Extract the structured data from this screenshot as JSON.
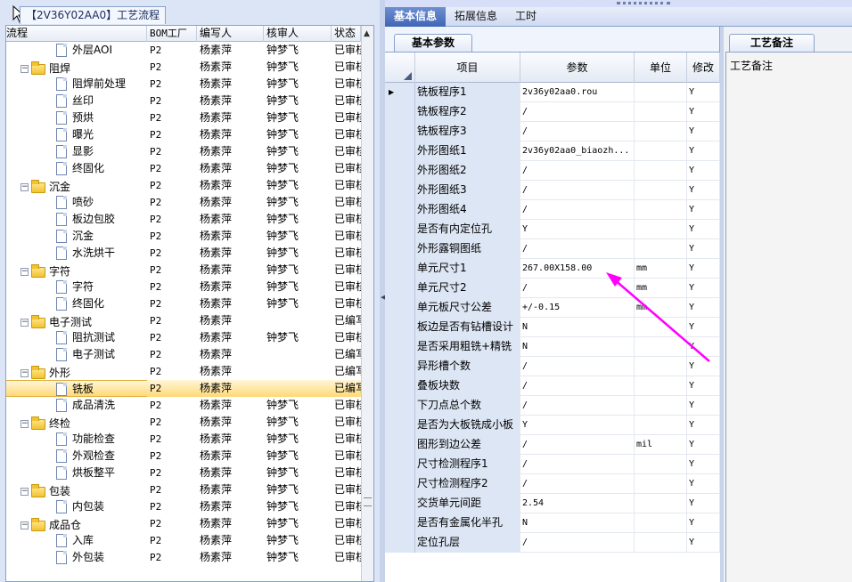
{
  "window": {
    "title": "【2V36Y02AA0】工艺流程"
  },
  "tree": {
    "columns": [
      "流程",
      "BOM工厂",
      "编写人",
      "核审人",
      "状态"
    ],
    "rows": [
      {
        "level": 1,
        "kind": "doc",
        "name": "外层AOI",
        "bom": "P2",
        "writer": "杨素萍",
        "reviewer": "钟梦飞",
        "status": "已审核",
        "selected": false
      },
      {
        "level": 0,
        "kind": "folder",
        "name": "阻焊",
        "bom": "P2",
        "writer": "杨素萍",
        "reviewer": "钟梦飞",
        "status": "已审核",
        "selected": false
      },
      {
        "level": 1,
        "kind": "doc",
        "name": "阻焊前处理",
        "bom": "P2",
        "writer": "杨素萍",
        "reviewer": "钟梦飞",
        "status": "已审核",
        "selected": false
      },
      {
        "level": 1,
        "kind": "doc",
        "name": "丝印",
        "bom": "P2",
        "writer": "杨素萍",
        "reviewer": "钟梦飞",
        "status": "已审核",
        "selected": false
      },
      {
        "level": 1,
        "kind": "doc",
        "name": "预烘",
        "bom": "P2",
        "writer": "杨素萍",
        "reviewer": "钟梦飞",
        "status": "已审核",
        "selected": false
      },
      {
        "level": 1,
        "kind": "doc",
        "name": "曝光",
        "bom": "P2",
        "writer": "杨素萍",
        "reviewer": "钟梦飞",
        "status": "已审核",
        "selected": false
      },
      {
        "level": 1,
        "kind": "doc",
        "name": "显影",
        "bom": "P2",
        "writer": "杨素萍",
        "reviewer": "钟梦飞",
        "status": "已审核",
        "selected": false
      },
      {
        "level": 1,
        "kind": "doc",
        "name": "终固化",
        "bom": "P2",
        "writer": "杨素萍",
        "reviewer": "钟梦飞",
        "status": "已审核",
        "selected": false
      },
      {
        "level": 0,
        "kind": "folder",
        "name": "沉金",
        "bom": "P2",
        "writer": "杨素萍",
        "reviewer": "钟梦飞",
        "status": "已审核",
        "selected": false
      },
      {
        "level": 1,
        "kind": "doc",
        "name": "喷砂",
        "bom": "P2",
        "writer": "杨素萍",
        "reviewer": "钟梦飞",
        "status": "已审核",
        "selected": false
      },
      {
        "level": 1,
        "kind": "doc",
        "name": "板边包胶",
        "bom": "P2",
        "writer": "杨素萍",
        "reviewer": "钟梦飞",
        "status": "已审核",
        "selected": false
      },
      {
        "level": 1,
        "kind": "doc",
        "name": "沉金",
        "bom": "P2",
        "writer": "杨素萍",
        "reviewer": "钟梦飞",
        "status": "已审核",
        "selected": false
      },
      {
        "level": 1,
        "kind": "doc",
        "name": "水洗烘干",
        "bom": "P2",
        "writer": "杨素萍",
        "reviewer": "钟梦飞",
        "status": "已审核",
        "selected": false
      },
      {
        "level": 0,
        "kind": "folder",
        "name": "字符",
        "bom": "P2",
        "writer": "杨素萍",
        "reviewer": "钟梦飞",
        "status": "已审核",
        "selected": false
      },
      {
        "level": 1,
        "kind": "doc",
        "name": "字符",
        "bom": "P2",
        "writer": "杨素萍",
        "reviewer": "钟梦飞",
        "status": "已审核",
        "selected": false
      },
      {
        "level": 1,
        "kind": "doc",
        "name": "终固化",
        "bom": "P2",
        "writer": "杨素萍",
        "reviewer": "钟梦飞",
        "status": "已审核",
        "selected": false
      },
      {
        "level": 0,
        "kind": "folder",
        "name": "电子测试",
        "bom": "P2",
        "writer": "杨素萍",
        "reviewer": "",
        "status": "已编写",
        "selected": false
      },
      {
        "level": 1,
        "kind": "doc",
        "name": "阻抗测试",
        "bom": "P2",
        "writer": "杨素萍",
        "reviewer": "钟梦飞",
        "status": "已审核",
        "selected": false
      },
      {
        "level": 1,
        "kind": "doc",
        "name": "电子测试",
        "bom": "P2",
        "writer": "杨素萍",
        "reviewer": "",
        "status": "已编写",
        "selected": false
      },
      {
        "level": 0,
        "kind": "folder",
        "name": "外形",
        "bom": "P2",
        "writer": "杨素萍",
        "reviewer": "",
        "status": "已编写",
        "selected": false
      },
      {
        "level": 1,
        "kind": "doc",
        "name": "铣板",
        "bom": "P2",
        "writer": "杨素萍",
        "reviewer": "",
        "status": "已编写",
        "selected": true
      },
      {
        "level": 1,
        "kind": "doc",
        "name": "成品清洗",
        "bom": "P2",
        "writer": "杨素萍",
        "reviewer": "钟梦飞",
        "status": "已审核",
        "selected": false
      },
      {
        "level": 0,
        "kind": "folder",
        "name": "终检",
        "bom": "P2",
        "writer": "杨素萍",
        "reviewer": "钟梦飞",
        "status": "已审核",
        "selected": false
      },
      {
        "level": 1,
        "kind": "doc",
        "name": "功能检查",
        "bom": "P2",
        "writer": "杨素萍",
        "reviewer": "钟梦飞",
        "status": "已审核",
        "selected": false
      },
      {
        "level": 1,
        "kind": "doc",
        "name": "外观检查",
        "bom": "P2",
        "writer": "杨素萍",
        "reviewer": "钟梦飞",
        "status": "已审核",
        "selected": false
      },
      {
        "level": 1,
        "kind": "doc",
        "name": "烘板整平",
        "bom": "P2",
        "writer": "杨素萍",
        "reviewer": "钟梦飞",
        "status": "已审核",
        "selected": false
      },
      {
        "level": 0,
        "kind": "folder",
        "name": "包装",
        "bom": "P2",
        "writer": "杨素萍",
        "reviewer": "钟梦飞",
        "status": "已审核",
        "selected": false
      },
      {
        "level": 1,
        "kind": "doc",
        "name": "内包装",
        "bom": "P2",
        "writer": "杨素萍",
        "reviewer": "钟梦飞",
        "status": "已审核",
        "selected": false
      },
      {
        "level": 0,
        "kind": "folder",
        "name": "成品仓",
        "bom": "P2",
        "writer": "杨素萍",
        "reviewer": "钟梦飞",
        "status": "已审核",
        "selected": false
      },
      {
        "level": 1,
        "kind": "doc",
        "name": "入库",
        "bom": "P2",
        "writer": "杨素萍",
        "reviewer": "钟梦飞",
        "status": "已审核",
        "selected": false
      },
      {
        "level": 1,
        "kind": "doc",
        "name": "外包装",
        "bom": "P2",
        "writer": "杨素萍",
        "reviewer": "钟梦飞",
        "status": "已审核",
        "selected": false
      }
    ]
  },
  "tabs": [
    "基本信息",
    "拓展信息",
    "工时"
  ],
  "active_tab": 0,
  "params_panel": {
    "tab_label": "基本参数",
    "columns": [
      "项目",
      "参数",
      "单位",
      "修改"
    ],
    "rows": [
      {
        "item": "铣板程序1",
        "value": "2v36y02aa0.rou",
        "unit": "",
        "mod": "Y",
        "current": true
      },
      {
        "item": "铣板程序2",
        "value": "/",
        "unit": "",
        "mod": "Y",
        "current": false
      },
      {
        "item": "铣板程序3",
        "value": "/",
        "unit": "",
        "mod": "Y",
        "current": false
      },
      {
        "item": "外形图纸1",
        "value": "2v36y02aa0_biaozh...",
        "unit": "",
        "mod": "Y",
        "current": false
      },
      {
        "item": "外形图纸2",
        "value": "/",
        "unit": "",
        "mod": "Y",
        "current": false
      },
      {
        "item": "外形图纸3",
        "value": "/",
        "unit": "",
        "mod": "Y",
        "current": false
      },
      {
        "item": "外形图纸4",
        "value": "/",
        "unit": "",
        "mod": "Y",
        "current": false
      },
      {
        "item": "是否有内定位孔",
        "value": "Y",
        "unit": "",
        "mod": "Y",
        "current": false
      },
      {
        "item": "外形露铜图纸",
        "value": "/",
        "unit": "",
        "mod": "Y",
        "current": false
      },
      {
        "item": "单元尺寸1",
        "value": "267.00X158.00",
        "unit": "mm",
        "mod": "Y",
        "current": false
      },
      {
        "item": "单元尺寸2",
        "value": "/",
        "unit": "mm",
        "mod": "Y",
        "current": false
      },
      {
        "item": "单元板尺寸公差",
        "value": "+/-0.15",
        "unit": "mm",
        "mod": "Y",
        "current": false
      },
      {
        "item": "板边是否有钻槽设计",
        "value": "N",
        "unit": "",
        "mod": "Y",
        "current": false
      },
      {
        "item": "是否采用粗铣+精铣",
        "value": "N",
        "unit": "",
        "mod": "Y",
        "current": false
      },
      {
        "item": "异形槽个数",
        "value": "/",
        "unit": "",
        "mod": "Y",
        "current": false
      },
      {
        "item": "叠板块数",
        "value": "/",
        "unit": "",
        "mod": "Y",
        "current": false
      },
      {
        "item": "下刀点总个数",
        "value": "/",
        "unit": "",
        "mod": "Y",
        "current": false
      },
      {
        "item": "是否为大板铣成小板",
        "value": "Y",
        "unit": "",
        "mod": "Y",
        "current": false
      },
      {
        "item": "图形到边公差",
        "value": "/",
        "unit": "mil",
        "mod": "Y",
        "current": false
      },
      {
        "item": "尺寸检测程序1",
        "value": "/",
        "unit": "",
        "mod": "Y",
        "current": false
      },
      {
        "item": "尺寸检测程序2",
        "value": "/",
        "unit": "",
        "mod": "Y",
        "current": false
      },
      {
        "item": "交货单元间距",
        "value": "2.54",
        "unit": "",
        "mod": "Y",
        "current": false
      },
      {
        "item": "是否有金属化半孔",
        "value": "N",
        "unit": "",
        "mod": "Y",
        "current": false
      },
      {
        "item": "定位孔层",
        "value": "/",
        "unit": "",
        "mod": "Y",
        "current": false
      }
    ]
  },
  "memo_panel": {
    "tab_label": "工艺备注",
    "header": "工艺备注"
  },
  "annotation": {
    "color": "#ff00ff"
  }
}
